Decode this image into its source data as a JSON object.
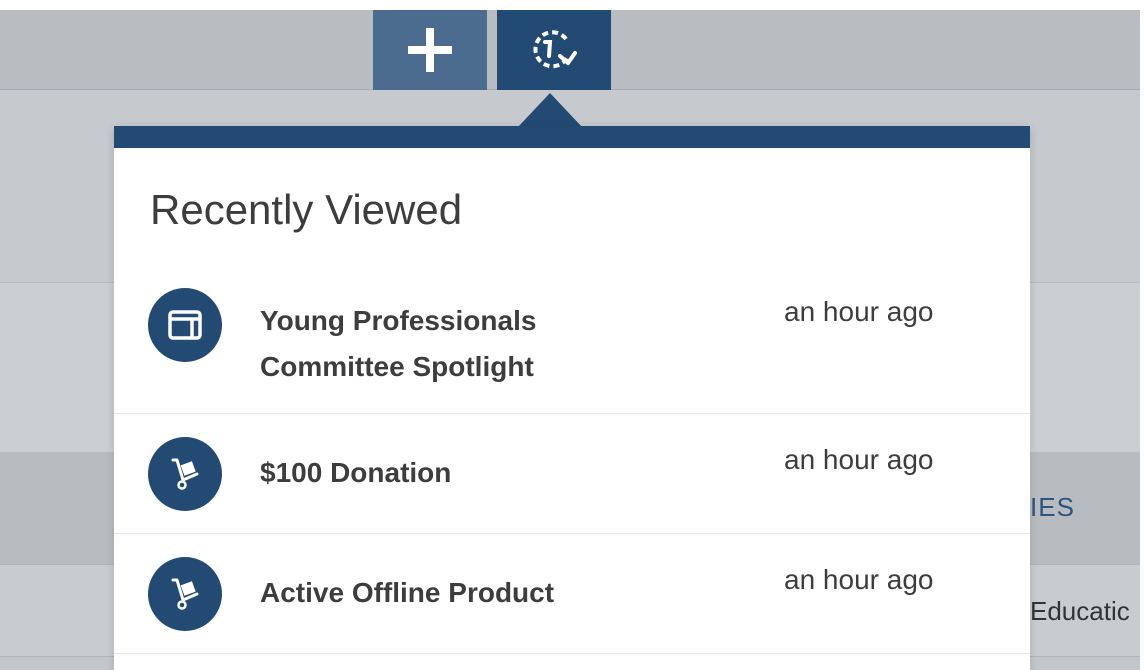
{
  "background": {
    "column_header_partial": "IES",
    "cell_partial": "Educatic"
  },
  "toolbar": {
    "add_icon": "plus-icon",
    "recent_icon": "recent-history-icon"
  },
  "recently_viewed": {
    "title": "Recently Viewed",
    "items": [
      {
        "icon": "page-icon",
        "label": "Young Professionals Committee Spotlight",
        "time": "an hour ago"
      },
      {
        "icon": "hand-truck-icon",
        "label": "$100 Donation",
        "time": "an hour ago"
      },
      {
        "icon": "hand-truck-icon",
        "label": "Active Offline Product",
        "time": "an hour ago"
      }
    ]
  },
  "colors": {
    "primary": "#234a73",
    "secondary": "#4c6c8f",
    "text": "#3d3d3d"
  }
}
